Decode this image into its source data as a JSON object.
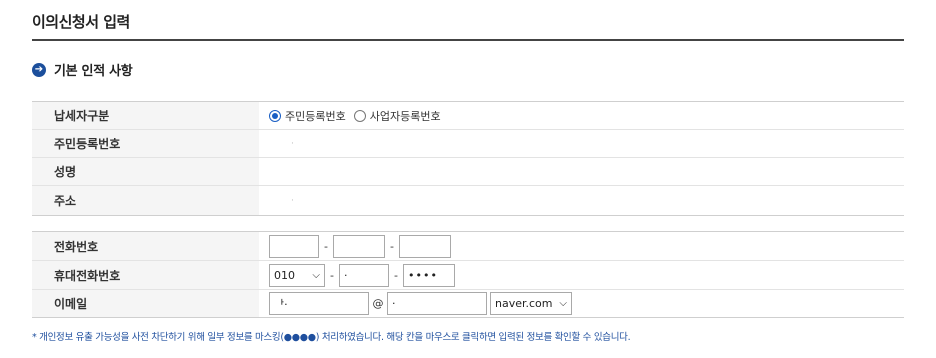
{
  "page": {
    "title": "이의신청서 입력"
  },
  "section": {
    "title": "기본 인적 사항",
    "bullet": "➔"
  },
  "basic": {
    "taxpayer_type_label": "납세자구분",
    "taxpayer_type_options": [
      "주민등록번호",
      "사업자등록번호"
    ],
    "taxpayer_type_selected": "주민등록번호",
    "rrn_label": "주민등록번호",
    "rrn_value": "·",
    "name_label": "성명",
    "name_value": "",
    "address_label": "주소",
    "address_value": "·"
  },
  "contact": {
    "phone_label": "전화번호",
    "phone_parts": [
      "",
      "",
      ""
    ],
    "dash": "-",
    "mobile_label": "휴대전화번호",
    "mobile_prefix": "010",
    "mobile_mid": "·",
    "mobile_last": "••••",
    "email_label": "이메일",
    "email_id": "ᅡ·",
    "at": "@",
    "email_domain_input": "·",
    "email_domain_select": "naver.com"
  },
  "notice": "* 개인정보 유출 가능성을 사전 차단하기 위해 일부 정보를 마스킹(●●●●) 처리하였습니다. 해당 칸을 마우스로 클릭하면 입력된 정보를 확인할 수 있습니다.",
  "colors": {
    "accent": "#1c4f9c",
    "notice": "#1f4f9e",
    "header_bg": "#f5f5f5"
  }
}
